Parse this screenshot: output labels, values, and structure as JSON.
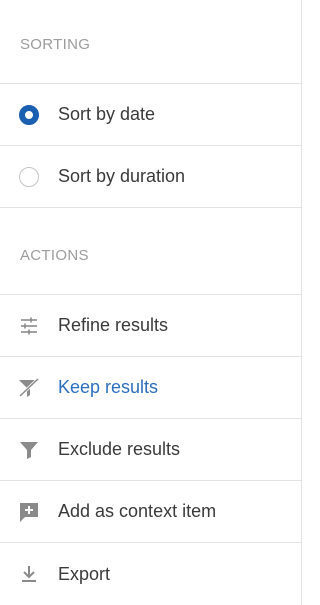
{
  "sorting": {
    "header": "SORTING",
    "options": [
      {
        "label": "Sort by date",
        "selected": true
      },
      {
        "label": "Sort by duration",
        "selected": false
      }
    ]
  },
  "actions": {
    "header": "ACTIONS",
    "items": [
      {
        "label": "Refine results",
        "icon": "sliders-icon"
      },
      {
        "label": "Keep results",
        "icon": "filter-keep-icon",
        "active": true
      },
      {
        "label": "Exclude results",
        "icon": "filter-icon"
      },
      {
        "label": "Add as context item",
        "icon": "add-comment-icon"
      },
      {
        "label": "Export",
        "icon": "download-icon"
      }
    ]
  },
  "colors": {
    "accent": "#1b5fb0",
    "active_text": "#2c6fbf",
    "header_text": "#9c9c9c",
    "icon": "#7a7a7a",
    "divider": "#e3e3e3"
  }
}
